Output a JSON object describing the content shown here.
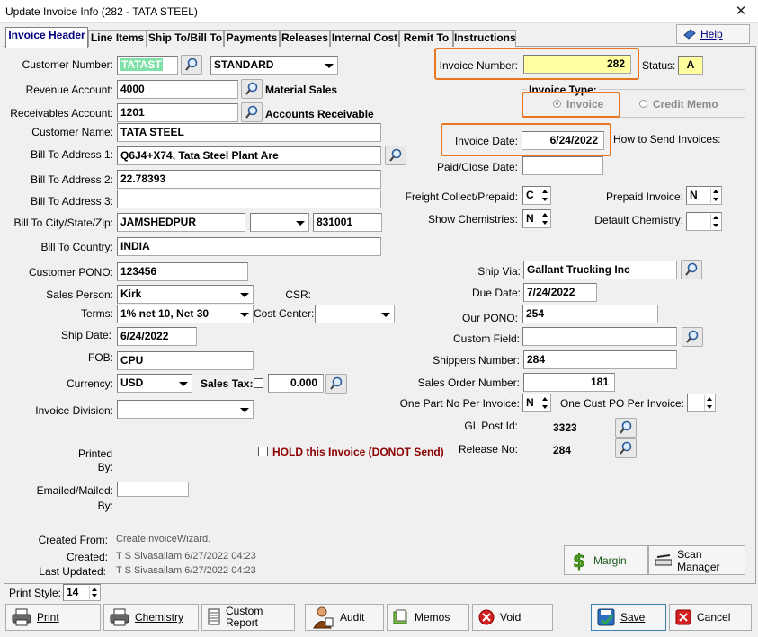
{
  "window": {
    "title": "Update Invoice Info  (282 - TATA STEEL)",
    "close": "✕"
  },
  "tabs": [
    {
      "label": "Invoice Header"
    },
    {
      "label": "Line Items"
    },
    {
      "label": "Ship To/Bill To"
    },
    {
      "label": "Payments"
    },
    {
      "label": "Releases"
    },
    {
      "label": "Internal Cost"
    },
    {
      "label": "Remit To"
    },
    {
      "label": "Instructions"
    }
  ],
  "help_label": "Help",
  "left": {
    "customer_number_label": "Customer Number:",
    "customer_number": "TATAST",
    "customer_type": "STANDARD",
    "revenue_label": "Revenue Account:",
    "revenue": "4000",
    "revenue_desc": "Material Sales",
    "receivables_label": "Receivables Account:",
    "receivables": "1201",
    "receivables_desc": "Accounts Receivable",
    "customer_name_label": "Customer Name:",
    "customer_name": "TATA STEEL",
    "bill1_label": "Bill To Address 1:",
    "bill1": "Q6J4+X74, Tata Steel Plant Are",
    "bill2_label": "Bill To Address 2:",
    "bill2": "22.78393",
    "bill3_label": "Bill To Address 3:",
    "bill3": "",
    "bill_city_label": "Bill To City/State/Zip:",
    "bill_city": "JAMSHEDPUR",
    "bill_state": "",
    "bill_zip": "831001",
    "bill_country_label": "Bill To Country:",
    "bill_country": "INDIA",
    "pono_label": "Customer PONO:",
    "pono": "123456",
    "sales_person_label": "Sales Person:",
    "sales_person": "Kirk",
    "csr_label": "CSR:",
    "terms_label": "Terms:",
    "terms": "1% net 10, Net 30",
    "cost_center_label": "Cost Center:",
    "cost_center": "",
    "ship_date_label": "Ship Date:",
    "ship_date": "6/24/2022",
    "fob_label": "FOB:",
    "fob": "CPU",
    "currency_label": "Currency:",
    "currency": "USD",
    "sales_tax_label": "Sales Tax:",
    "sales_tax": "0.000",
    "division_label": "Invoice Division:",
    "division": "",
    "printed_label": "Printed",
    "printed_by": "By:",
    "emailed_label": "Emailed/Mailed:",
    "emailed_by": "By:",
    "emailed_value": "",
    "hold_label": "HOLD this Invoice (DONOT Send)",
    "created_from_label": "Created From:",
    "created_from": "CreateInvoiceWizard.",
    "created_label": "Created:",
    "created": "T S Sivasailam 6/27/2022 04:23",
    "updated_label": "Last Updated:",
    "updated": "T S Sivasailam 6/27/2022 04:23"
  },
  "right": {
    "invoice_number_label": "Invoice Number:",
    "invoice_number": "282",
    "status_label": "Status:",
    "status": "A",
    "invoice_type_label": "Invoice Type:",
    "invoice_type_invoice": "Invoice",
    "invoice_type_credit": "Credit Memo",
    "invoice_date_label": "Invoice Date:",
    "invoice_date": "6/24/2022",
    "how_send_label": "How to Send Invoices:",
    "paid_label": "Paid/Close Date:",
    "paid": "",
    "freight_label": "Freight Collect/Prepaid:",
    "freight": "C",
    "prepaid_inv_label": "Prepaid Invoice:",
    "prepaid_inv": "N",
    "show_chem_label": "Show Chemistries:",
    "show_chem": "N",
    "default_chem_label": "Default Chemistry:",
    "default_chem": "",
    "ship_via_label": "Ship Via:",
    "ship_via": "Gallant Trucking Inc",
    "due_label": "Due Date:",
    "due": "7/24/2022",
    "our_pono_label": "Our PONO:",
    "our_pono": "254",
    "custom_field_label": "Custom Field:",
    "custom_field": "",
    "shippers_label": "Shippers Number:",
    "shippers": "284",
    "so_label": "Sales Order Number:",
    "so": "181",
    "one_part_label": "One Part No Per Invoice:",
    "one_part": "N",
    "one_cust_label": "One Cust PO Per Invoice:",
    "one_cust": "",
    "gl_label": "GL Post Id:",
    "gl": "3323",
    "release_label": "Release No:",
    "release": "284",
    "margin_label": "Margin",
    "scan_label": "Scan Manager"
  },
  "footer": {
    "print_style_label": "Print Style:",
    "print_style": "14",
    "print": "Print",
    "chemistry": "Chemistry",
    "custom_report": "Custom\nReport",
    "audit": "Audit",
    "memos": "Memos",
    "void": "Void",
    "save": "Save",
    "cancel": "Cancel"
  },
  "colors": {
    "invoice_number_bg": "#ffffa0",
    "highlight": "#e87722",
    "selected": "#7fe0a8",
    "hold": "#8b0000",
    "tab_active": "#000080"
  }
}
